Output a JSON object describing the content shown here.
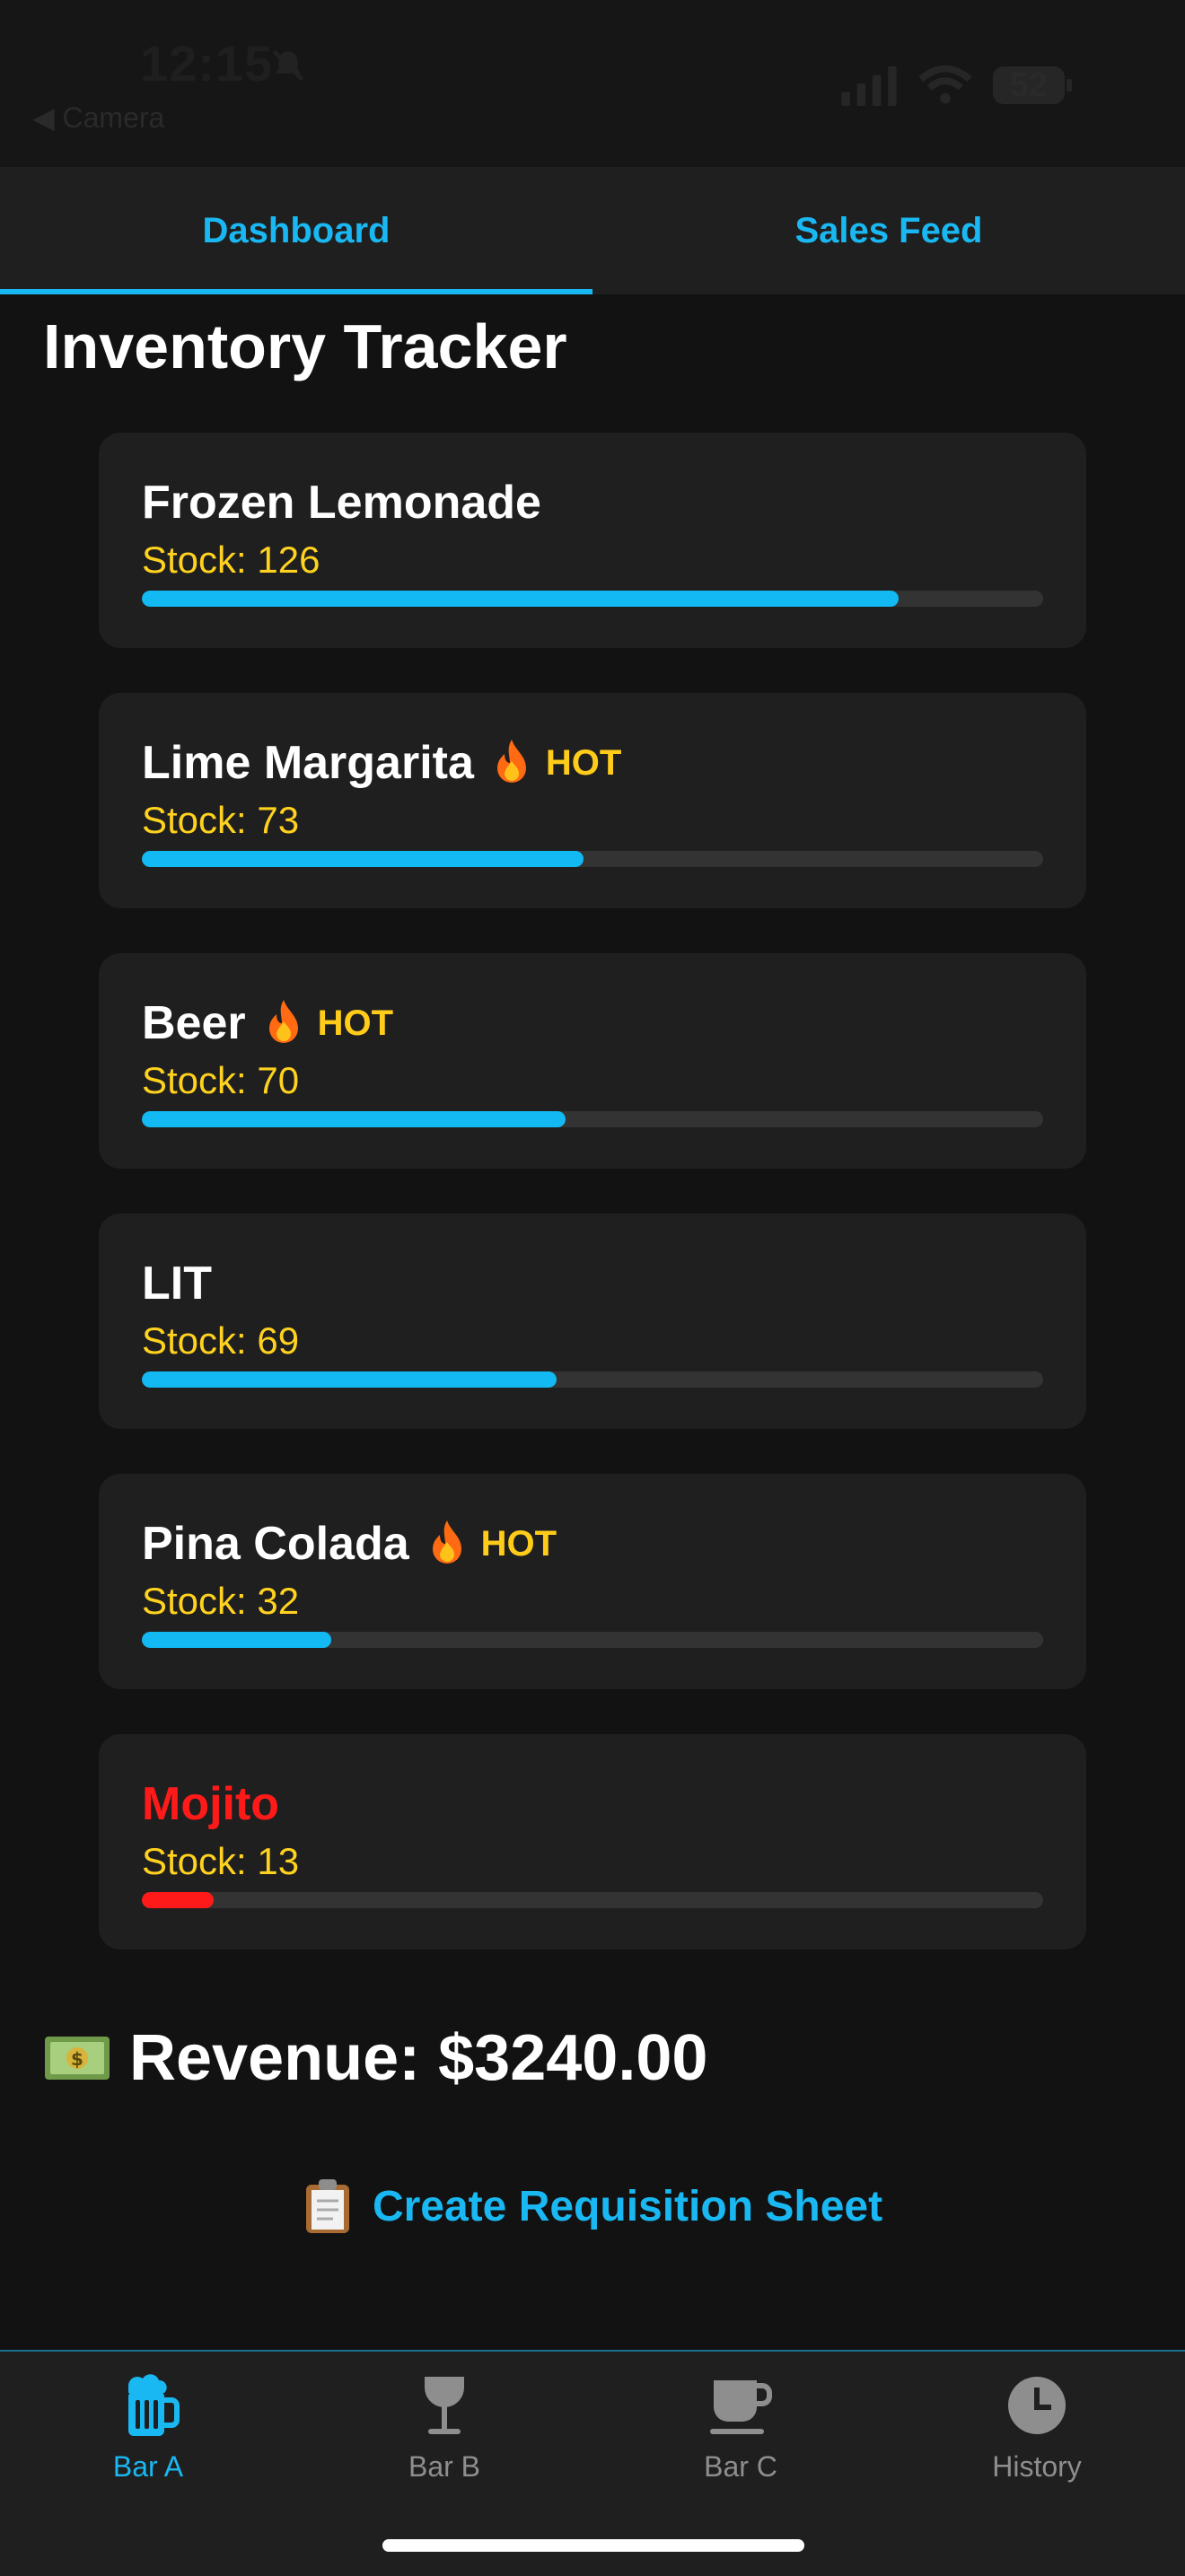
{
  "status_bar": {
    "time": "12:15",
    "back_label": "◀ Camera",
    "battery": "52"
  },
  "tabs": [
    {
      "label": "Dashboard",
      "active": true
    },
    {
      "label": "Sales Feed",
      "active": false
    }
  ],
  "page_title": "Inventory Tracker",
  "hot_label": "HOT",
  "items": [
    {
      "name": "Frozen Lemonade",
      "stock": "Stock: 126",
      "level": 0.84,
      "hot": false,
      "low": false
    },
    {
      "name": "Lime Margarita",
      "stock": "Stock: 73",
      "level": 0.49,
      "hot": true,
      "low": false
    },
    {
      "name": "Beer",
      "stock": "Stock: 70",
      "level": 0.47,
      "hot": true,
      "low": false
    },
    {
      "name": "LIT",
      "stock": "Stock: 69",
      "level": 0.46,
      "hot": false,
      "low": false
    },
    {
      "name": "Pina Colada",
      "stock": "Stock: 32",
      "level": 0.21,
      "hot": true,
      "low": false
    },
    {
      "name": "Mojito",
      "stock": "Stock: 13",
      "level": 0.08,
      "hot": false,
      "low": true
    }
  ],
  "revenue": {
    "label": "Revenue: $3240.00",
    "icon": "money-icon"
  },
  "requisition": {
    "label": "Create Requisition Sheet",
    "icon": "clipboard-icon"
  },
  "bottom_nav": [
    {
      "label": "Bar A",
      "icon": "beer-mug-icon",
      "active": true
    },
    {
      "label": "Bar B",
      "icon": "wine-glass-icon",
      "active": false
    },
    {
      "label": "Bar C",
      "icon": "coffee-cup-icon",
      "active": false
    },
    {
      "label": "History",
      "icon": "clock-icon",
      "active": false
    }
  ],
  "colors": {
    "accent": "#1ab8f2",
    "stock_text": "#ffd21f",
    "low_stock": "#ff1a1a",
    "background": "#121212",
    "card": "#1f1f1f"
  }
}
